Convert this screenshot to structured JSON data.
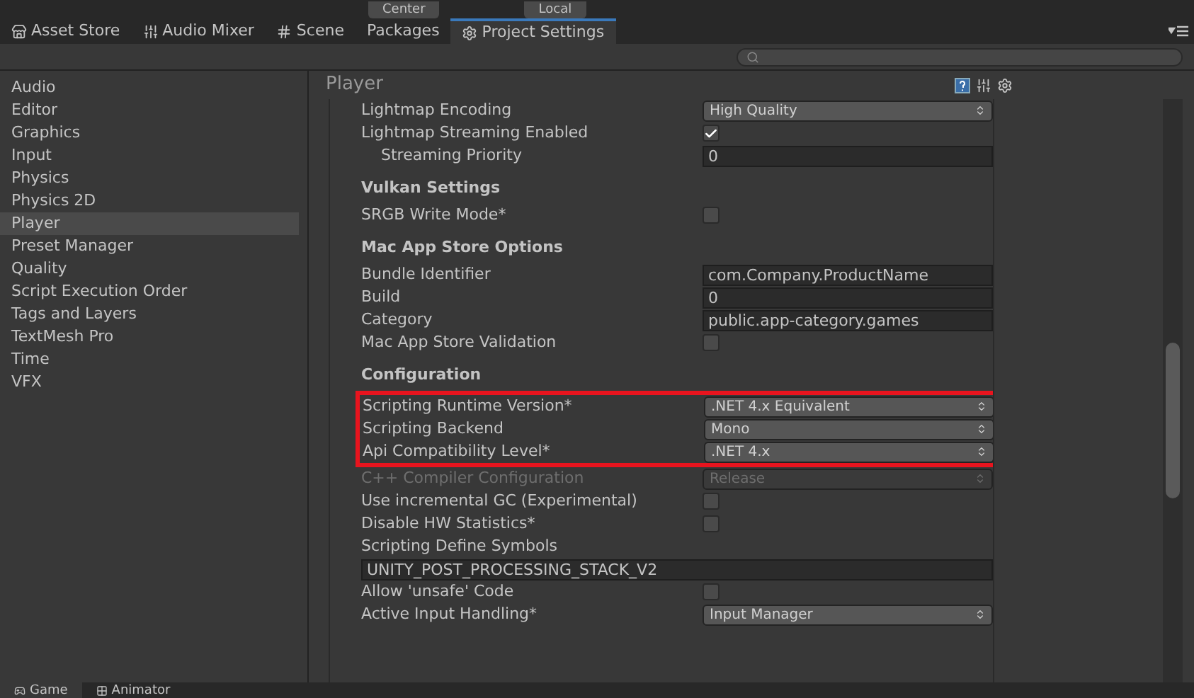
{
  "toolbar": {
    "buttons": [
      "Center",
      "Local"
    ]
  },
  "tabs": [
    {
      "label": "Asset Store",
      "selected": false
    },
    {
      "label": "Audio Mixer",
      "selected": false
    },
    {
      "label": "Scene",
      "selected": false
    },
    {
      "label": "Packages",
      "selected": false
    },
    {
      "label": "Project Settings",
      "selected": true
    }
  ],
  "sidebar": {
    "items": [
      {
        "label": "Audio",
        "selected": false
      },
      {
        "label": "Editor",
        "selected": false
      },
      {
        "label": "Graphics",
        "selected": false
      },
      {
        "label": "Input",
        "selected": false
      },
      {
        "label": "Physics",
        "selected": false
      },
      {
        "label": "Physics 2D",
        "selected": false
      },
      {
        "label": "Player",
        "selected": true
      },
      {
        "label": "Preset Manager",
        "selected": false
      },
      {
        "label": "Quality",
        "selected": false
      },
      {
        "label": "Script Execution Order",
        "selected": false
      },
      {
        "label": "Tags and Layers",
        "selected": false
      },
      {
        "label": "TextMesh Pro",
        "selected": false
      },
      {
        "label": "Time",
        "selected": false
      },
      {
        "label": "VFX",
        "selected": false
      }
    ]
  },
  "inspector": {
    "title": "Player",
    "rows": [
      {
        "kind": "dropdown",
        "label": "Lightmap Encoding",
        "value": "High Quality"
      },
      {
        "kind": "checkbox",
        "label": "Lightmap Streaming Enabled",
        "checked": true,
        "children": [
          {
            "kind": "text",
            "label": "Streaming Priority",
            "value": "0"
          }
        ]
      },
      {
        "kind": "header",
        "label": "Vulkan Settings"
      },
      {
        "kind": "checkbox",
        "label": "SRGB Write Mode*",
        "checked": false
      },
      {
        "kind": "header",
        "label": "Mac App Store Options"
      },
      {
        "kind": "text",
        "label": "Bundle Identifier",
        "value": "com.Company.ProductName"
      },
      {
        "kind": "text",
        "label": "Build",
        "value": "0"
      },
      {
        "kind": "text",
        "label": "Category",
        "value": "public.app-category.games"
      },
      {
        "kind": "checkbox",
        "label": "Mac App Store Validation",
        "checked": false
      },
      {
        "kind": "header",
        "label": "Configuration"
      },
      {
        "kind": "group",
        "highlighted": true,
        "rows": [
          {
            "kind": "dropdown",
            "label": "Scripting Runtime Version*",
            "value": ".NET 4.x Equivalent"
          },
          {
            "kind": "dropdown",
            "label": "Scripting Backend",
            "value": "Mono"
          },
          {
            "kind": "dropdown",
            "label": "Api Compatibility Level*",
            "value": ".NET 4.x"
          }
        ]
      },
      {
        "kind": "dropdown",
        "label": "C++ Compiler Configuration",
        "value": "Release",
        "disabled": true
      },
      {
        "kind": "checkbox",
        "label": "Use incremental GC (Experimental)",
        "checked": false
      },
      {
        "kind": "checkbox",
        "label": "Disable HW Statistics*",
        "checked": false
      },
      {
        "kind": "label",
        "label": "Scripting Define Symbols"
      },
      {
        "kind": "wide_text",
        "value": "UNITY_POST_PROCESSING_STACK_V2"
      },
      {
        "kind": "checkbox",
        "label": "Allow 'unsafe' Code",
        "checked": false
      },
      {
        "kind": "dropdown",
        "label": "Active Input Handling*",
        "value": "Input Manager"
      }
    ]
  },
  "bottom_tabs": [
    {
      "label": "Game",
      "selected": true
    },
    {
      "label": "Animator",
      "selected": false
    }
  ]
}
